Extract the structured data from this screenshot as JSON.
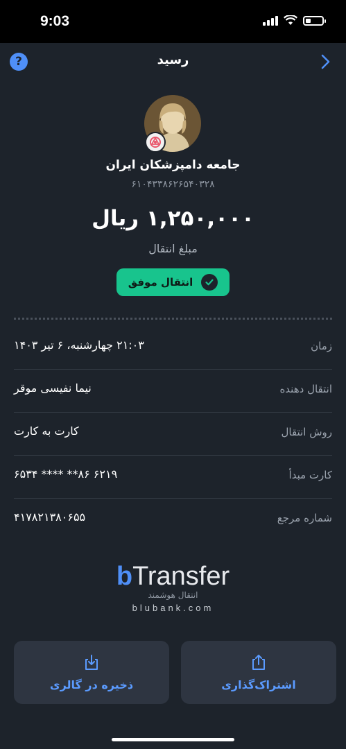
{
  "status_bar": {
    "time": "9:03"
  },
  "nav": {
    "title": "رسید",
    "help_icon": "?"
  },
  "recipient": {
    "name": "جامعه دامپزشکان ایران",
    "card_number": "۶۱۰۴۳۳۸۶۲۶۵۴۰۳۲۸"
  },
  "amount": {
    "value": "۱,۲۵۰,۰۰۰ ریال",
    "label": "مبلغ انتقال"
  },
  "status": {
    "text": "انتقال موفق",
    "color": "#18c48d"
  },
  "details": [
    {
      "label": "زمان",
      "value": "۲۱:۰۳ چهارشنبه، ۶ تیر ۱۴۰۳"
    },
    {
      "label": "انتقال دهنده",
      "value": "نیما نفیسی موقر"
    },
    {
      "label": "روش انتقال",
      "value": "کارت به کارت"
    },
    {
      "label": "کارت مبدأ",
      "value": "۶۵۳۴ **** **۸۶ ۶۲۱۹"
    },
    {
      "label": "شماره مرجع",
      "value": "۴۱۷۸۲۱۳۸۰۶۵۵"
    }
  ],
  "branding": {
    "logo_b": "b",
    "logo_text": "Transfer",
    "tagline": "انتقال هوشمند",
    "url": "blubank.com"
  },
  "actions": {
    "save": "ذخیره در گالری",
    "share": "اشتراک‌گذاری"
  },
  "colors": {
    "background": "#1d232b",
    "accent": "#4f8ff7",
    "success": "#18c48d"
  }
}
